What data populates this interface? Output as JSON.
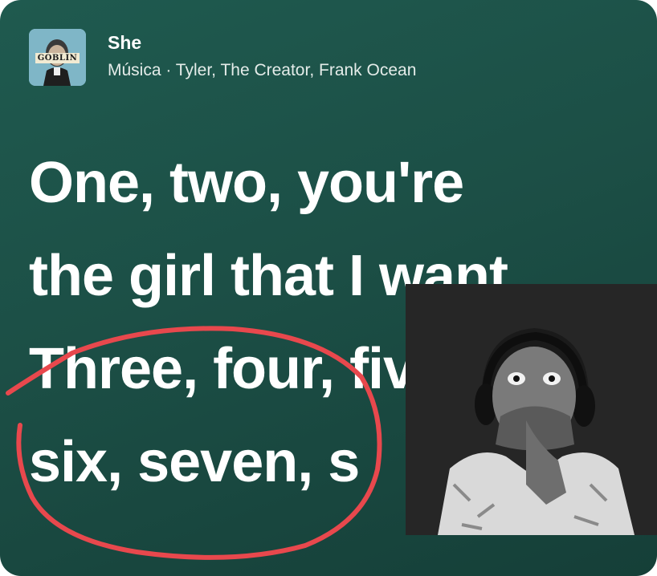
{
  "track": {
    "title": "She",
    "subtitle": "Música · Tyler, The Creator, Frank Ocean",
    "album_art_text": "GOBLIN"
  },
  "lyrics": [
    "One, two, you're",
    "the girl that I want",
    "Three, four, five,",
    "six, seven, s"
  ],
  "annotation": {
    "color": "#e8484d"
  },
  "colors": {
    "background": "#1c4f46",
    "text": "#ffffff"
  }
}
